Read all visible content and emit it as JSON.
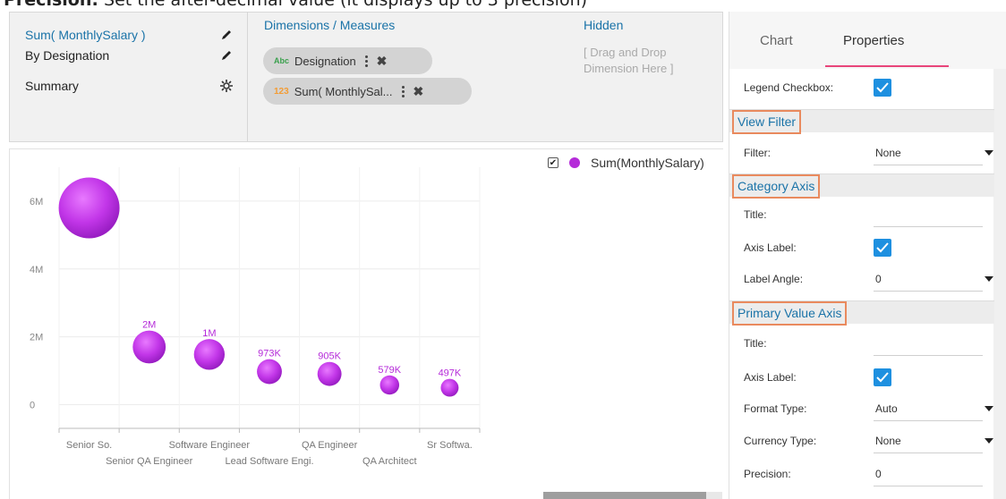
{
  "caption": {
    "bold": "Precision:",
    "text": " Set the after-decimal value (it displays up to 3 precision)"
  },
  "config": {
    "rows": [
      {
        "label": "Sum( MonthlySalary )",
        "icon": "pencil-icon"
      },
      {
        "label": "By Designation",
        "icon": "pencil-icon"
      },
      {
        "label": "Summary",
        "icon": "gear-icon"
      }
    ],
    "dimensions_title": "Dimensions / Measures",
    "pills": [
      {
        "tag": "Abc",
        "label": "Designation"
      },
      {
        "tag": "123",
        "label": "Sum( MonthlySal..."
      }
    ],
    "hidden_title": "Hidden",
    "hidden_hint": "[ Drag and Drop Dimension Here ]"
  },
  "legend": {
    "checked": true,
    "label": "Sum(MonthlySalary)"
  },
  "chart_data": {
    "type": "scatter",
    "title": "",
    "xlabel": "",
    "ylabel": "",
    "ylim": [
      -700000,
      7000000
    ],
    "y_ticks": [
      {
        "value": 0,
        "label": "0"
      },
      {
        "value": 2000000,
        "label": "2M"
      },
      {
        "value": 4000000,
        "label": "4M"
      },
      {
        "value": 6000000,
        "label": "6M"
      }
    ],
    "categories": [
      "Senior So.",
      "Senior QA Engineer",
      "Software Engineer",
      "Lead Software Engi.",
      "QA Engineer",
      "QA Architect",
      "Sr Softwa."
    ],
    "series": [
      {
        "name": "Sum(MonthlySalary)",
        "color": "#b52bd9",
        "points": [
          {
            "x": "Senior So.",
            "y": 5800000,
            "label": ""
          },
          {
            "x": "Senior QA Engineer",
            "y": 1700000,
            "label": "2M"
          },
          {
            "x": "Software Engineer",
            "y": 1480000,
            "label": "1M"
          },
          {
            "x": "Lead Software Engi.",
            "y": 973000,
            "label": "973K"
          },
          {
            "x": "QA Engineer",
            "y": 905000,
            "label": "905K"
          },
          {
            "x": "QA Architect",
            "y": 579000,
            "label": "579K"
          },
          {
            "x": "Sr Softwa.",
            "y": 497000,
            "label": "497K"
          }
        ]
      }
    ],
    "grid": true,
    "legend_position": "top-right"
  },
  "properties": {
    "tabs": [
      "Chart",
      "Properties"
    ],
    "active_tab": "Properties",
    "legend_checkbox_label": "Legend Checkbox:",
    "view_filter": {
      "title": "View Filter",
      "filter_label": "Filter:",
      "filter_value": "None"
    },
    "category_axis": {
      "title": "Category Axis",
      "title_label": "Title:",
      "axis_label_label": "Axis Label:",
      "label_angle_label": "Label Angle:",
      "label_angle_value": "0"
    },
    "primary_value_axis": {
      "title": "Primary Value Axis",
      "title_label": "Title:",
      "axis_label_label": "Axis Label:",
      "format_type_label": "Format Type:",
      "format_type_value": "Auto",
      "currency_type_label": "Currency Type:",
      "currency_type_value": "None",
      "precision_label": "Precision:",
      "precision_value": "0"
    }
  }
}
